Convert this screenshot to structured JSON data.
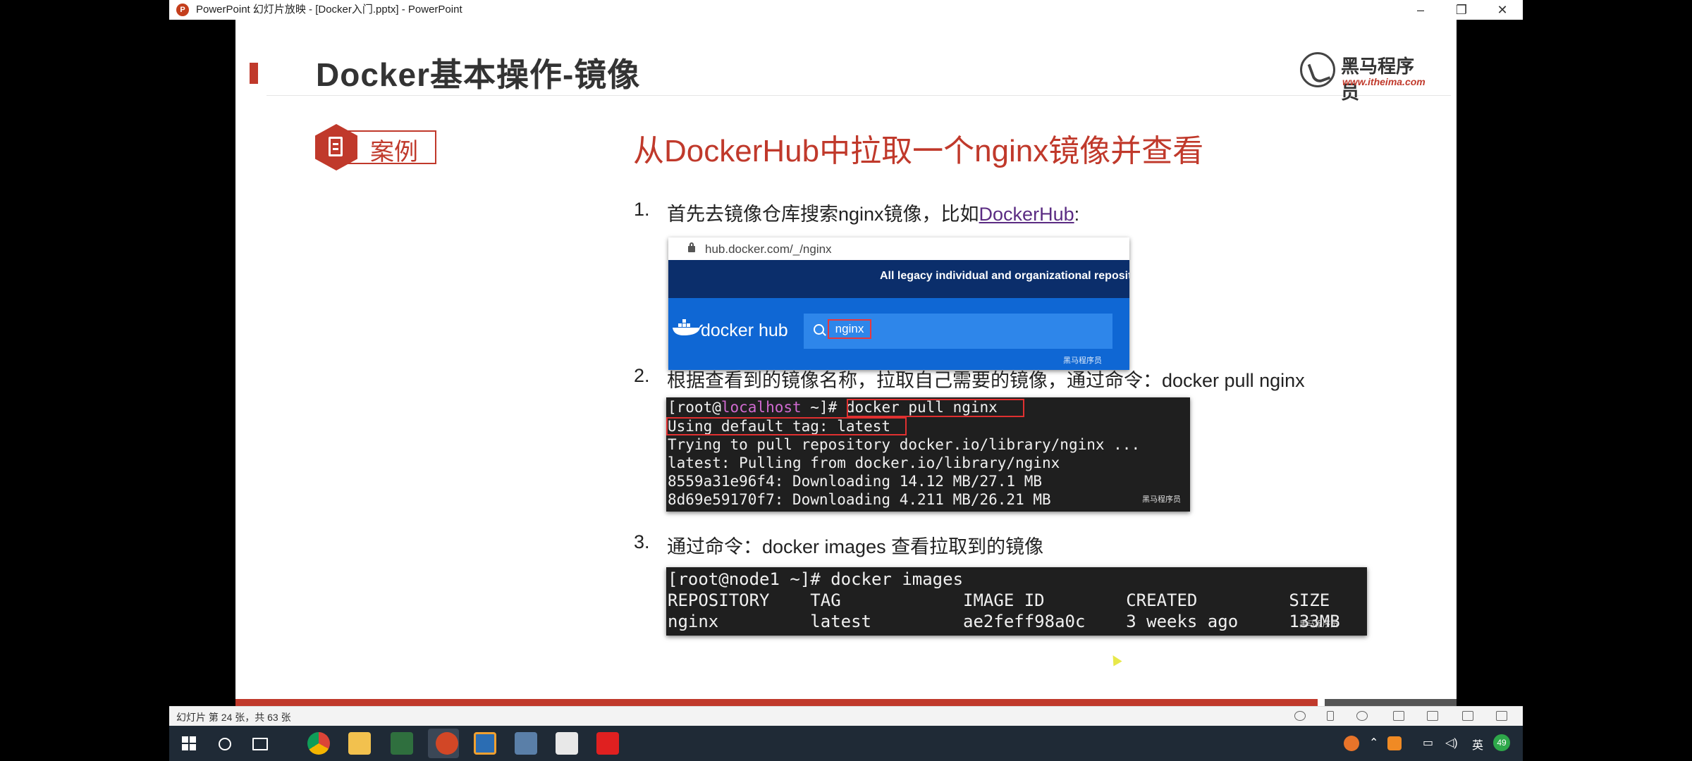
{
  "window": {
    "title": "PowerPoint 幻灯片放映 - [Docker入门.pptx] - PowerPoint",
    "minimize": "–",
    "restore": "❐",
    "close": "✕"
  },
  "slide": {
    "title": "Docker基本操作-镜像",
    "logo": {
      "brand": "黑马程序员",
      "url": "www.itheima.com"
    },
    "case_label": "案例",
    "case_title": "从DockerHub中拉取一个nginx镜像并查看",
    "steps": [
      {
        "num": "1.",
        "text": "首先去镜像仓库搜索nginx镜像，比如",
        "link": "DockerHub",
        "suffix": ":"
      },
      {
        "num": "2.",
        "text": "根据查看到的镜像名称，拉取自己需要的镜像，通过命令：docker pull nginx"
      },
      {
        "num": "3.",
        "text": "通过命令：docker images 查看拉取到的镜像"
      }
    ],
    "hub_screenshot": {
      "url": "hub.docker.com/_/nginx",
      "banner": "All legacy individual and organizational reposit",
      "brand": "docker hub",
      "query": "nginx",
      "watermark": "黑马程序员"
    },
    "pull_terminal": {
      "prompt_user": "[root@",
      "prompt_host": "localhost",
      "prompt_rest": " ~]# ",
      "command": "docker pull nginx",
      "lines": [
        "Using default tag: latest",
        "Trying to pull repository docker.io/library/nginx ...",
        "latest: Pulling from docker.io/library/nginx",
        "8559a31e96f4: Downloading 14.12 MB/27.1 MB",
        "8d69e59170f7: Downloading 4.211 MB/26.21 MB"
      ],
      "watermark": "黑马程序员"
    },
    "images_terminal": {
      "lines": [
        "[root@node1 ~]# docker images",
        "REPOSITORY    TAG            IMAGE ID        CREATED         SIZE",
        "nginx         latest         ae2feff98a0c    3 weeks ago     133MB"
      ],
      "watermark": "黑马程序员"
    }
  },
  "statusbar": {
    "slide_info": "幻灯片 第 24 张，共 63 张"
  },
  "taskbar": {
    "tray": {
      "lang": "英",
      "badge": "49"
    }
  },
  "colors": {
    "accent": "#c0392b",
    "titlebar": "#ffffff",
    "taskbar": "#1f2a36"
  }
}
